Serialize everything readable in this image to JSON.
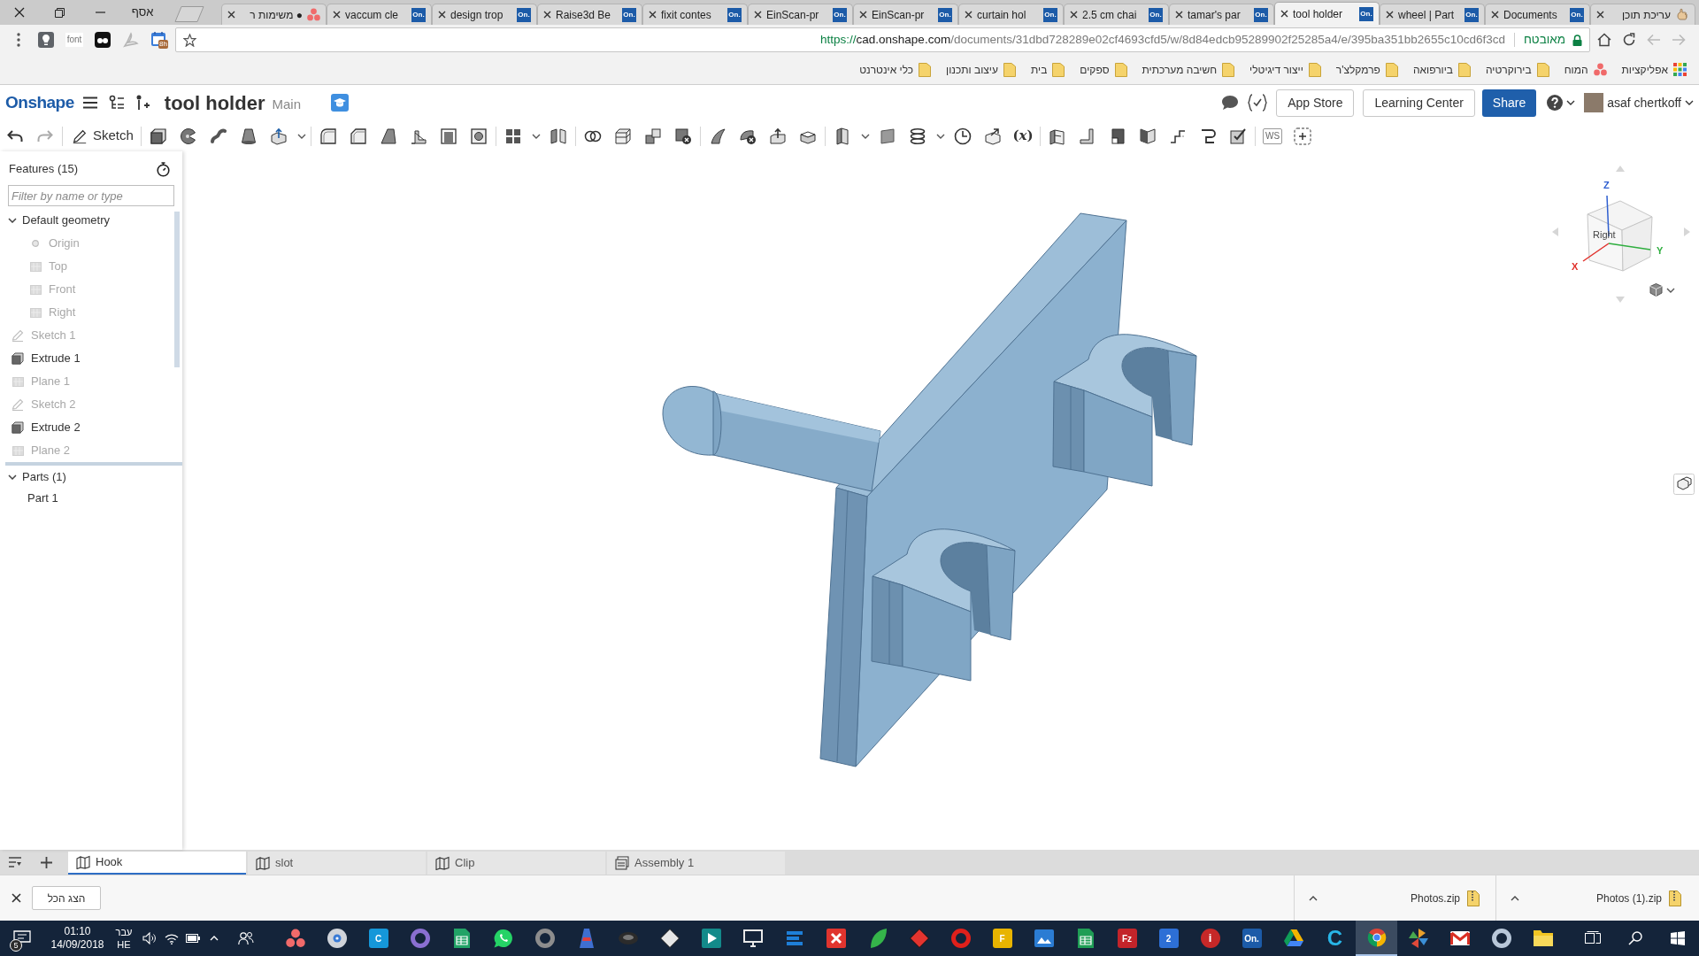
{
  "browser": {
    "profile_name": "אסף",
    "tabs": [
      {
        "title": "● משימות ר",
        "kind": "asana",
        "selected": false
      },
      {
        "title": "vaccum cle",
        "kind": "onshape",
        "favicon_text": "On.",
        "selected": false
      },
      {
        "title": "design trop",
        "kind": "onshape",
        "favicon_text": "On.",
        "selected": false
      },
      {
        "title": "Raise3d Be",
        "kind": "onshape",
        "favicon_text": "On.",
        "selected": false
      },
      {
        "title": "fixit contes",
        "kind": "onshape",
        "favicon_text": "On.",
        "selected": false
      },
      {
        "title": "EinScan-pr",
        "kind": "onshape",
        "favicon_text": "On.",
        "selected": false
      },
      {
        "title": "EinScan-pr",
        "kind": "onshape",
        "favicon_text": "On.",
        "selected": false
      },
      {
        "title": "curtain hol",
        "kind": "onshape",
        "favicon_text": "On.",
        "selected": false
      },
      {
        "title": "2.5 cm chai",
        "kind": "onshape",
        "favicon_text": "On.",
        "selected": false
      },
      {
        "title": "tamar's par",
        "kind": "onshape",
        "favicon_text": "On.",
        "selected": false
      },
      {
        "title": "tool holder",
        "kind": "onshape",
        "favicon_text": "On.",
        "selected": true
      },
      {
        "title": "wheel | Part",
        "kind": "onshape",
        "favicon_text": "On.",
        "selected": false
      },
      {
        "title": "Documents",
        "kind": "onshape",
        "favicon_text": "On.",
        "selected": false
      },
      {
        "title": "עריכת תוכן",
        "kind": "hand",
        "selected": false
      }
    ],
    "extensions": {
      "font_label": "font",
      "calendar_badge": "8h"
    },
    "address": {
      "scheme": "https://",
      "host": "cad.onshape.com",
      "path": "/documents/31dbd728289e02cf4693cfd5/w/8d84edcb95289902f25285a4/e/395ba351bb2655c10cd6f3cd",
      "security_label": "מאובטח"
    },
    "bookmarks": [
      {
        "label": "אפליקציות",
        "kind": "apps"
      },
      {
        "label": "המוח",
        "kind": "asana"
      },
      {
        "label": "בירוקרטיה",
        "kind": "folder"
      },
      {
        "label": "ביורפואה",
        "kind": "folder"
      },
      {
        "label": "פרמקלצ'ר",
        "kind": "folder"
      },
      {
        "label": "ייצור דיגיטלי",
        "kind": "folder"
      },
      {
        "label": "חשיבה מערכתית",
        "kind": "folder"
      },
      {
        "label": "ספקים",
        "kind": "folder"
      },
      {
        "label": "בית",
        "kind": "folder"
      },
      {
        "label": "עיצוב ותכנון",
        "kind": "folder"
      },
      {
        "label": "כלי אינטרנט",
        "kind": "folder"
      }
    ]
  },
  "onshape": {
    "logo": "Onshape",
    "document_title": "tool holder",
    "workspace": "Main",
    "buttons": [
      {
        "label": "App Store",
        "kind": "outline"
      },
      {
        "label": "Learning Center",
        "kind": "outline"
      },
      {
        "label": "Share",
        "kind": "primary"
      }
    ],
    "user_name": "asaf chertkoff",
    "toolbar": {
      "sketch_label": "Sketch",
      "variables_label": "(*x*)",
      "workspace_label": "WS"
    }
  },
  "feature_panel": {
    "title": "Features (15)",
    "filter_placeholder": "Filter by name or type",
    "items": [
      {
        "label": "Default geometry",
        "kind": "group",
        "expanded": true,
        "children": [
          {
            "label": "Origin",
            "kind": "origin",
            "hidden": true
          },
          {
            "label": "Top",
            "kind": "plane",
            "hidden": true
          },
          {
            "label": "Front",
            "kind": "plane",
            "hidden": true
          },
          {
            "label": "Right",
            "kind": "plane",
            "hidden": true
          }
        ]
      },
      {
        "label": "Sketch 1",
        "kind": "sketch",
        "hidden": true
      },
      {
        "label": "Extrude 1",
        "kind": "extrude",
        "hidden": false
      },
      {
        "label": "Plane 1",
        "kind": "plane",
        "hidden": true
      },
      {
        "label": "Sketch 2",
        "kind": "sketch",
        "hidden": true
      },
      {
        "label": "Extrude 2",
        "kind": "extrude",
        "hidden": false
      },
      {
        "label": "Plane 2",
        "kind": "plane",
        "hidden": true
      }
    ],
    "parts": {
      "label": "Parts (1)",
      "expanded": true,
      "children": [
        {
          "label": "Part 1"
        }
      ]
    }
  },
  "view_cube": {
    "face_label": "Right",
    "axes": [
      {
        "label": "Z",
        "color": "#2f5fd0"
      },
      {
        "label": "X",
        "color": "#e0302a"
      },
      {
        "label": "Y",
        "color": "#2fae3f"
      }
    ]
  },
  "document_tabs": [
    {
      "label": "Hook",
      "kind": "part_studio",
      "selected": true
    },
    {
      "label": "slot",
      "kind": "part_studio",
      "selected": false
    },
    {
      "label": "Clip",
      "kind": "part_studio",
      "selected": false
    },
    {
      "label": "Assembly 1",
      "kind": "assembly",
      "selected": false
    }
  ],
  "downloads": {
    "show_all_label": "הצג הכל",
    "items": [
      {
        "filename": "Photos.zip"
      },
      {
        "filename": "Photos (1).zip"
      }
    ]
  },
  "taskbar": {
    "notification_count": "5",
    "time": "01:10",
    "date": "14/09/2018",
    "language": "עבר",
    "keyboard": "HE",
    "apps": [
      {
        "kind": "dots",
        "color": "#f06a6a",
        "selected": false
      },
      {
        "kind": "disc",
        "color": "#d0d4da",
        "selected": false
      },
      {
        "kind": "tile",
        "color": "#1597d9",
        "label": "C",
        "selected": false
      },
      {
        "kind": "ring",
        "color": "#8a6fd1",
        "selected": false
      },
      {
        "kind": "sheet",
        "color": "#21a366",
        "selected": false
      },
      {
        "kind": "bubble",
        "color": "#25d366",
        "selected": false
      },
      {
        "kind": "ring",
        "color": "#8d8d8d",
        "selected": false
      },
      {
        "kind": "tower",
        "color": "#3f6fd1",
        "selected": false
      },
      {
        "kind": "blob",
        "color": "#2b2b2b",
        "selected": false
      },
      {
        "kind": "diamond",
        "color": "#e6e6e6",
        "selected": false
      },
      {
        "kind": "play",
        "color": "#138a8a",
        "selected": false
      },
      {
        "kind": "monitor",
        "color": "#e8e8e8",
        "selected": false
      },
      {
        "kind": "stripes",
        "color": "#1e7fd8",
        "selected": false
      },
      {
        "kind": "cross",
        "color": "#e0342e",
        "selected": false
      },
      {
        "kind": "leaf",
        "color": "#35b44a",
        "selected": false
      },
      {
        "kind": "diamond",
        "color": "#e3342f",
        "selected": false
      },
      {
        "kind": "ring",
        "color": "#e0201b",
        "selected": false
      },
      {
        "kind": "tile",
        "color": "#e8b400",
        "label": "F",
        "selected": false
      },
      {
        "kind": "picture",
        "color": "#2b7cd3",
        "selected": false
      },
      {
        "kind": "sheet",
        "color": "#1f9d55",
        "selected": false
      },
      {
        "kind": "tile",
        "color": "#c3242a",
        "label": "Fz",
        "selected": false
      },
      {
        "kind": "tile",
        "color": "#2d6fd6",
        "label": "2",
        "selected": false
      },
      {
        "kind": "circle",
        "color": "#c62828",
        "label": "i",
        "selected": false
      },
      {
        "kind": "tile",
        "color": "#1c5ba8",
        "label": "On.",
        "selected": false
      },
      {
        "kind": "drive",
        "color": "#f4b400",
        "selected": false
      },
      {
        "kind": "letter",
        "color": "#28b6e8",
        "label": "C",
        "selected": false
      },
      {
        "kind": "chrome",
        "selected": true
      },
      {
        "kind": "pinwheel",
        "selected": false
      },
      {
        "kind": "mail",
        "color": "#d93025",
        "selected": false
      },
      {
        "kind": "ring",
        "color": "#b8c7d9",
        "selected": false
      },
      {
        "kind": "folder",
        "color": "#f3c623",
        "selected": false
      }
    ]
  }
}
